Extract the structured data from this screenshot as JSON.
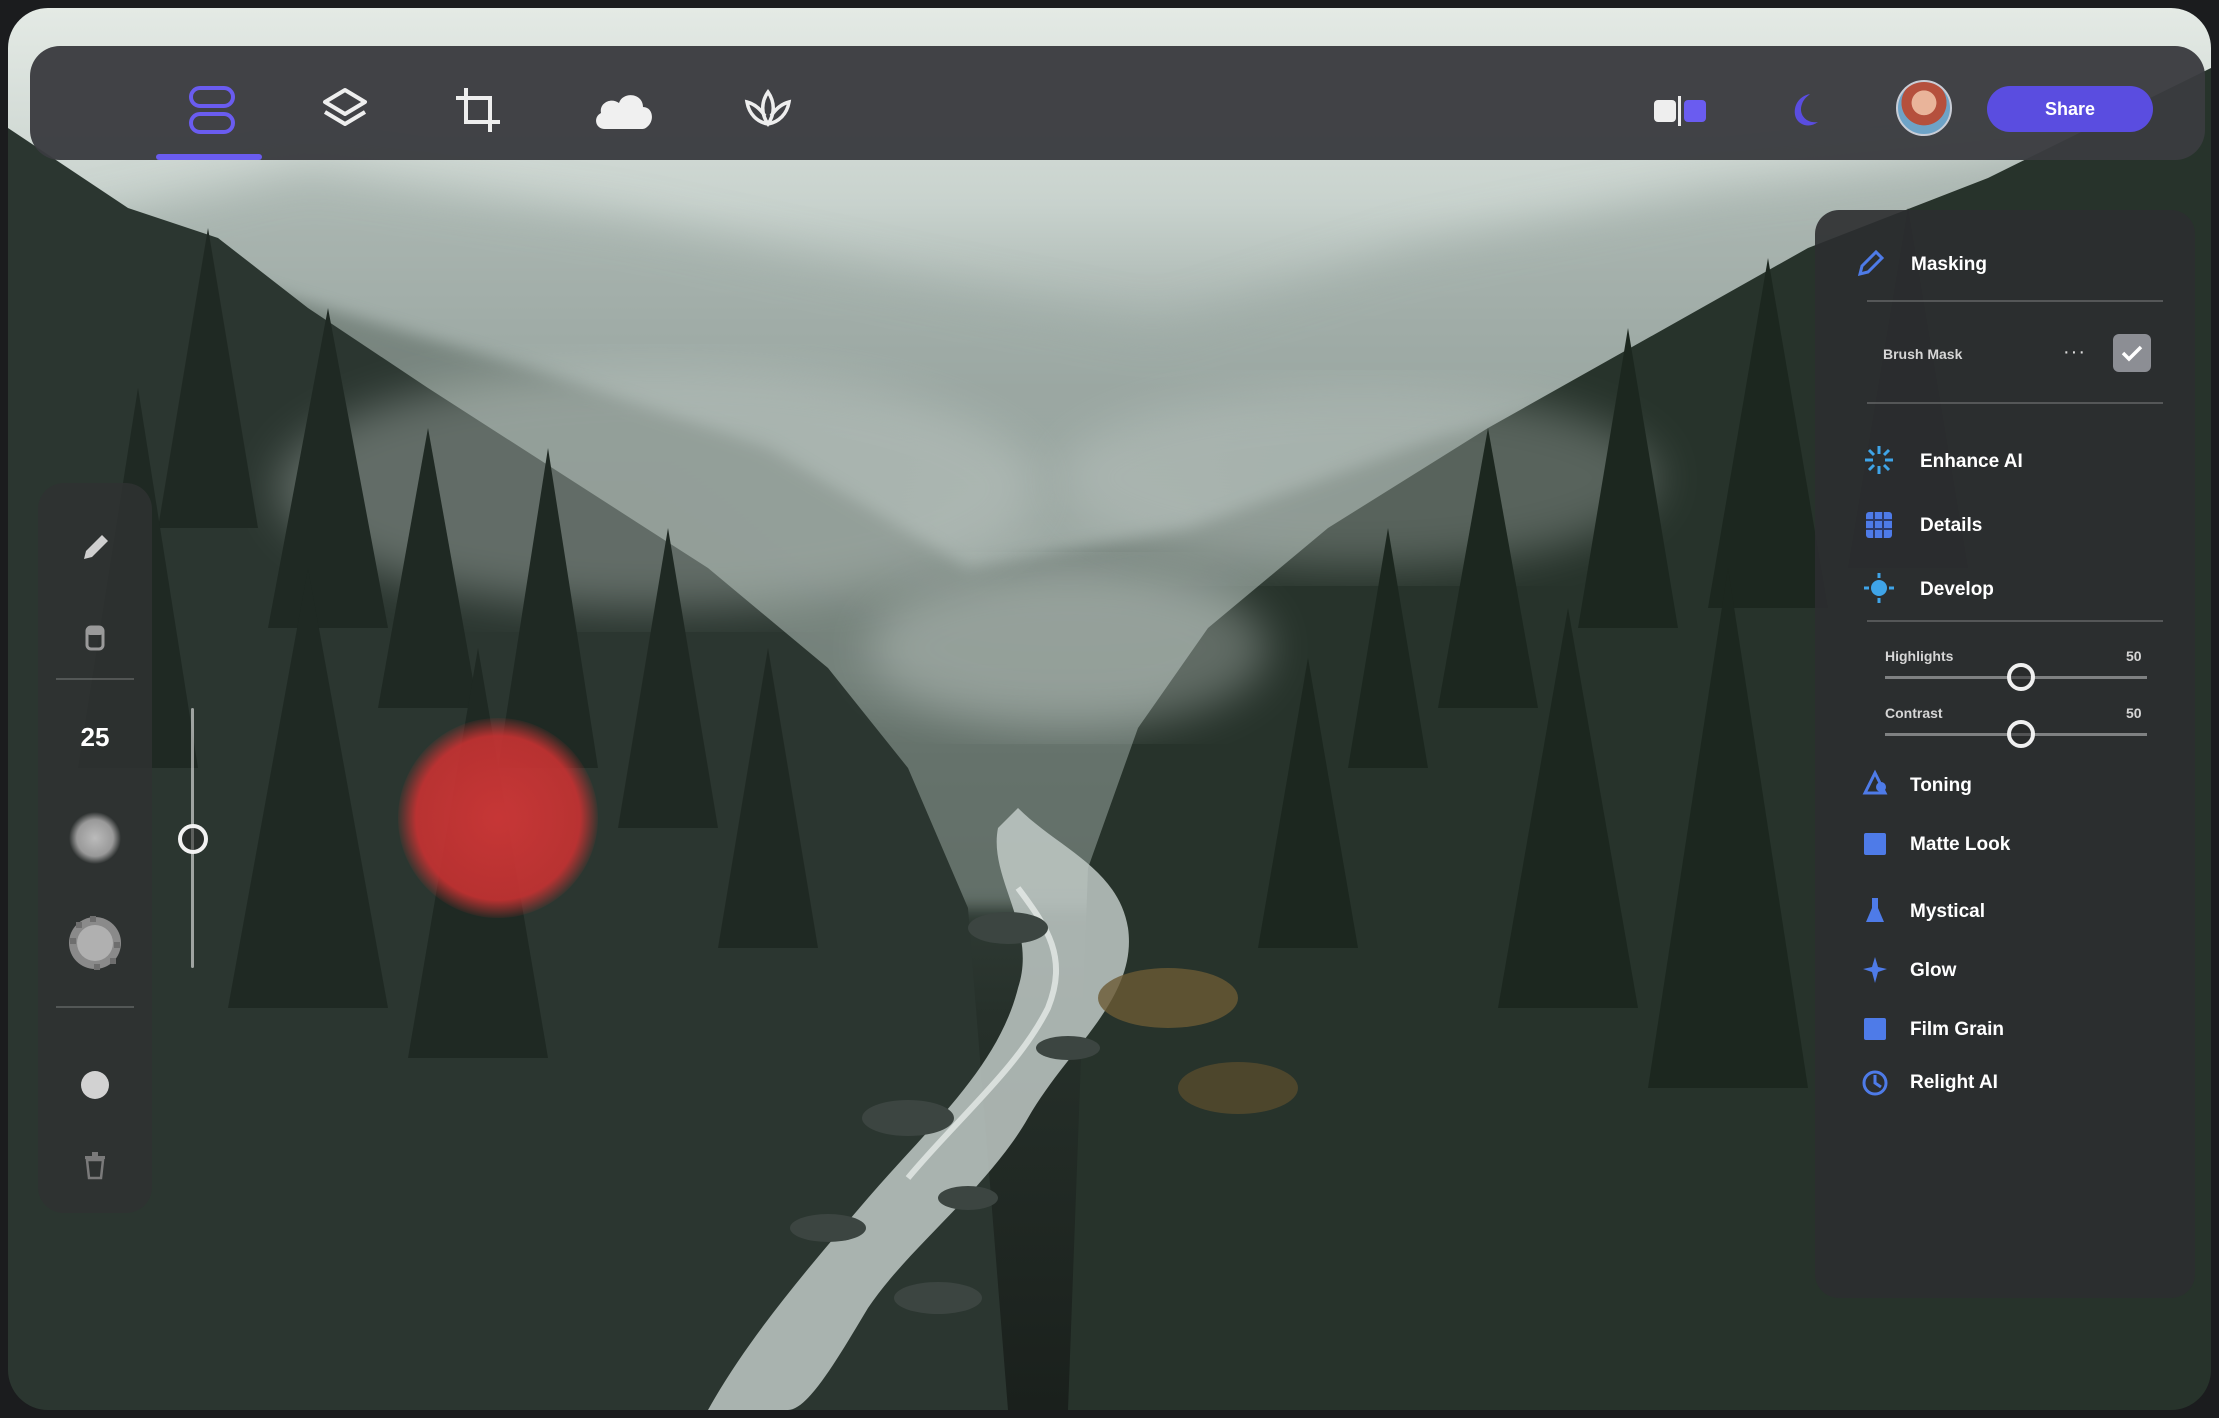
{
  "toolbar": {
    "tabs": [
      {
        "icon": "stack-icon",
        "active": true
      },
      {
        "icon": "layers-icon",
        "active": false
      },
      {
        "icon": "crop-icon",
        "active": false
      },
      {
        "icon": "cloud-icon",
        "active": false
      },
      {
        "icon": "lotus-icon",
        "active": false
      }
    ],
    "compare_icon": "compare-toggle-icon",
    "theme_icon": "moon-icon",
    "share_label": "Share",
    "accent_color": "#5a4de0"
  },
  "tool_rail": {
    "tools": [
      "pencil-icon",
      "eraser-icon"
    ],
    "brush_size": "25",
    "extra_tools": [
      "brush-softness-icon",
      "brush-texture-icon",
      "fill-dot-icon",
      "trash-icon"
    ],
    "brush_size_level": 0.5
  },
  "masking_panel": {
    "title": "Masking",
    "mask_name": "Brush Mask",
    "mask_enabled": true,
    "items": [
      {
        "label": "Enhance AI",
        "icon": "sparkle-icon"
      },
      {
        "label": "Details",
        "icon": "grid-icon"
      },
      {
        "label": "Develop",
        "icon": "sun-icon"
      }
    ],
    "sliders": [
      {
        "label": "Highlights",
        "value": "50",
        "level": 0.5
      },
      {
        "label": "Contrast",
        "value": "50",
        "level": 0.5
      }
    ],
    "presets": [
      {
        "label": "Toning",
        "icon": "toning-icon"
      },
      {
        "label": "Matte Look",
        "icon": "square-icon"
      },
      {
        "label": "Mystical",
        "icon": "flask-icon"
      },
      {
        "label": "Glow",
        "icon": "glow-icon"
      },
      {
        "label": "Film Grain",
        "icon": "square-icon"
      },
      {
        "label": "Relight AI",
        "icon": "relight-icon"
      }
    ],
    "icon_color": "#4e7be8"
  }
}
